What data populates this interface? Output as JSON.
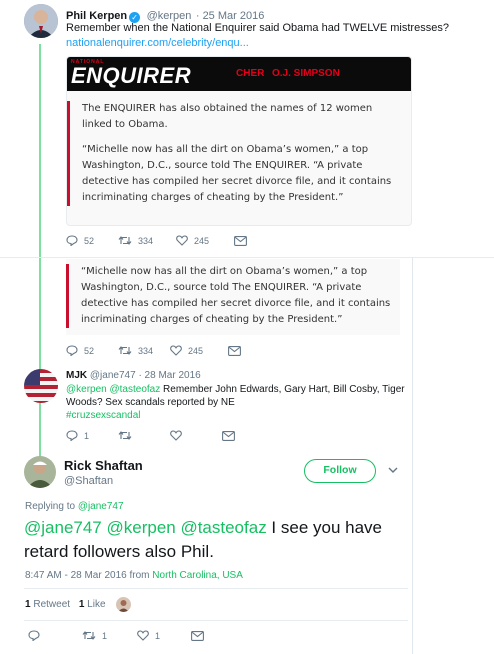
{
  "colors": {
    "accent": "#1da1f2",
    "thread_line": "#7ee0a0",
    "quote_border": "#c8102e",
    "follow_green": "#17bf63"
  },
  "tweet1": {
    "name": "Phil Kerpen",
    "handle": "@kerpen",
    "date": "· 25 Mar 2016",
    "text": "Remember when the National Enquirer said Obama had TWELVE mistresses?",
    "link": "nationalenquirer.com/celebrity/enqu...",
    "card": {
      "brand_small": "NATIONAL",
      "brand": "ENQUIRER",
      "tag1": "CHER",
      "tag2": "O.J. SIMPSON",
      "para1": "The ENQUIRER has also obtained the names of 12 women linked to Obama.",
      "para2": "“Michelle now has all the dirt on Obama’s women,” a top Washington, D.C., source told The ENQUIRER. “A private detective has compiled her secret divorce file, and it contains incriminating charges of cheating by the President.”"
    },
    "replies": "52",
    "retweets": "334",
    "likes": "245"
  },
  "tweet1_repeat": {
    "para": "“Michelle now has all the dirt on Obama’s women,” a top Washington, D.C., source told The ENQUIRER. “A private detective has compiled her secret divorce file, and it contains incriminating charges of cheating by the President.”",
    "replies": "52",
    "retweets": "334",
    "likes": "245"
  },
  "tweet2": {
    "name": "MJK",
    "handle": "@jane747",
    "date": "· 28 Mar 2016",
    "mentions": "@kerpen @tasteofaz",
    "text": "Remember John Edwards, Gary Hart, Bill Cosby, Tiger Woods? Sex scandals reported by NE",
    "hashtag": "#cruzsexscandal",
    "replies": "1"
  },
  "main_tweet": {
    "name": "Rick Shaftan",
    "handle": "@Shaftan",
    "follow_label": "Follow",
    "replying_to_label": "Replying to",
    "replying_to_handle": "@jane747",
    "mentions": "@jane747 @kerpen @tasteofaz",
    "text": " I see you have retard followers also Phil.",
    "time": "8:47 AM - 28 Mar 2016 from",
    "location": "North Carolina, USA",
    "retweet_count": "1",
    "retweet_label": "Retweet",
    "like_count": "1",
    "like_label": "Like",
    "reply_retweets": "1",
    "reply_likes": "1"
  }
}
